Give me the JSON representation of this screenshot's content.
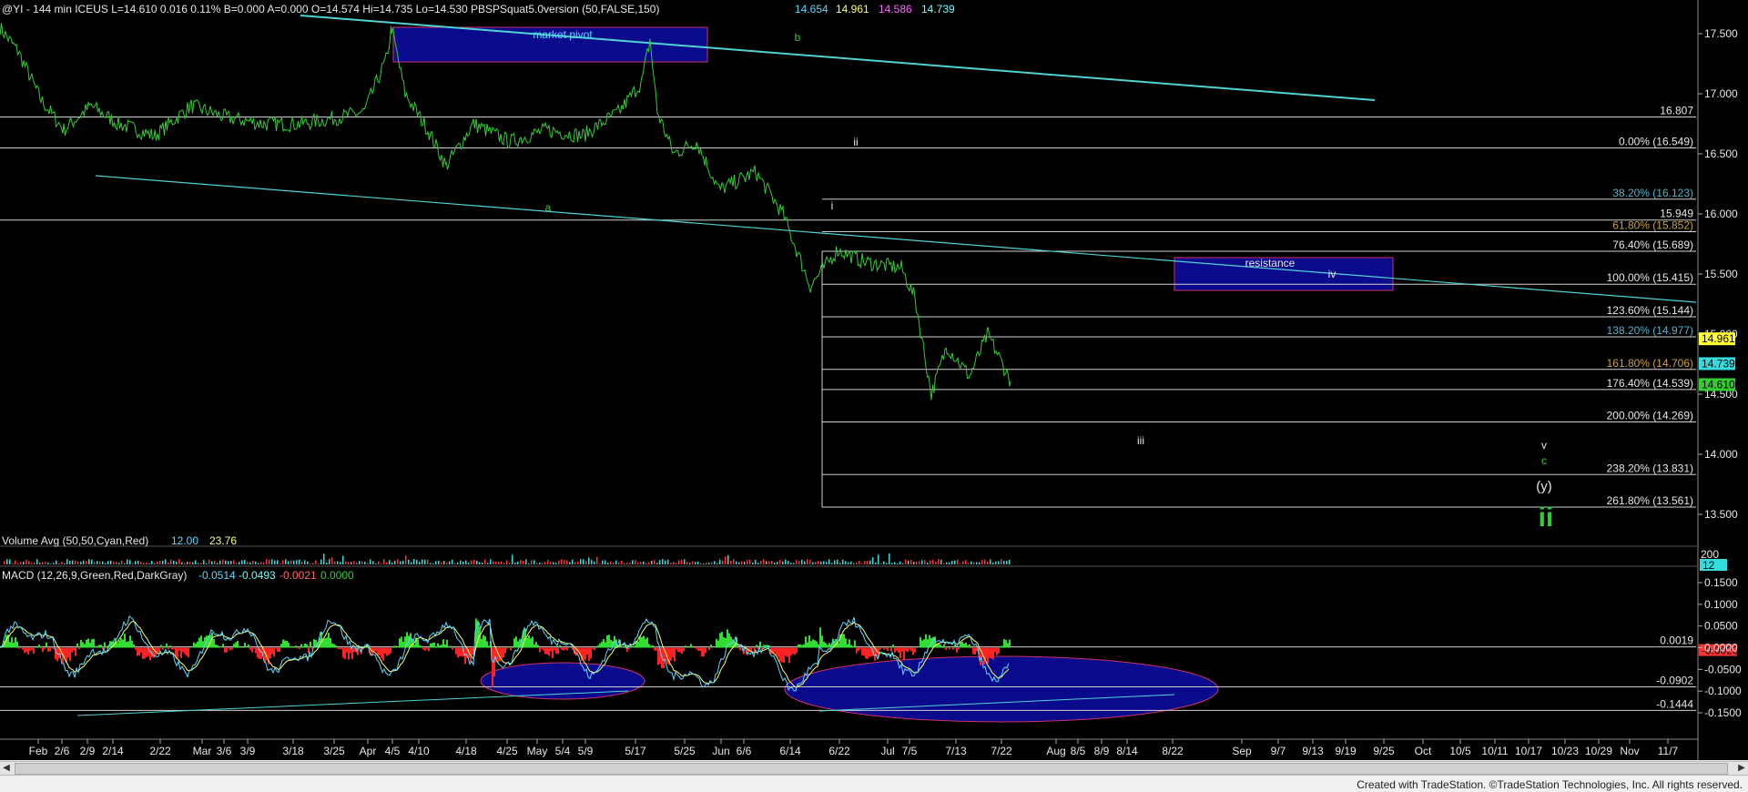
{
  "header": {
    "symbol_line": "@YI - 144 min  ICEUS  L=14.610  0.016  0.11%  B=0.000  A=0.000  O=14.574  Hi=14.735  Lo=14.530  PBSPSquat5.0version (50,FALSE,150)",
    "vals": [
      "14.654",
      "14.961",
      "14.586",
      "14.739"
    ],
    "val_colors": [
      "#5ad8ff",
      "#ffff66",
      "#ff66ff",
      "#66ffff"
    ]
  },
  "volume_header": {
    "text": "Volume Avg (50,50,Cyan,Red)",
    "v1": "12.00",
    "v2": "23.76"
  },
  "macd_header": {
    "text": "MACD (12,26,9,Green,Red,DarkGray)",
    "vals": [
      "-0.0514",
      "-0.0493",
      "-0.0021",
      "0.0000"
    ],
    "val_colors": [
      "#5ad8ff",
      "#66ffff",
      "#ff6666",
      "#33cc33"
    ]
  },
  "annotations": {
    "market_pivot": "market pivot",
    "resistance": "resistance",
    "waves": {
      "a": "a",
      "b": "b",
      "i": "i",
      "ii": "ii",
      "iii": "iii",
      "iv": "iv",
      "v": "v",
      "c": "c",
      "y": "(y)",
      "big_ii": "ii"
    }
  },
  "footer": "Created with TradeStation. ©TradeStation Technologies, Inc. All rights reserved.",
  "colors": {
    "price": "#33cc33",
    "trend": "#4fd2d2",
    "box": "#0a0a8c",
    "box_border": "#cc3366",
    "fib": "#e6e6e6"
  },
  "chart_data": [
    {
      "type": "line",
      "panel": "price",
      "ylim": [
        13.3,
        17.75
      ],
      "y_ticks": [
        "17.500",
        "17.000",
        "16.500",
        "16.000",
        "15.500",
        "15.000",
        "14.500",
        "14.000",
        "13.500"
      ],
      "x_ticks": [
        "Feb",
        "2/6",
        "2/9",
        "2/14",
        "2/22",
        "Mar",
        "3/6",
        "3/9",
        "3/18",
        "3/25",
        "Apr",
        "4/5",
        "4/10",
        "4/18",
        "4/25",
        "May",
        "5/4",
        "5/9",
        "5/17",
        "5/25",
        "Jun",
        "6/6",
        "6/14",
        "6/22",
        "Jul",
        "7/5",
        "7/13",
        "7/22",
        "Aug",
        "8/5",
        "8/9",
        "8/14",
        "8/22",
        "Sep",
        "9/7",
        "9/13",
        "9/19",
        "9/25",
        "Oct",
        "10/5",
        "10/11",
        "10/17",
        "10/23",
        "10/29",
        "Nov",
        "11/7"
      ],
      "price_key": [
        {
          "x": 0,
          "y": 17.55
        },
        {
          "x": 20,
          "y": 17.35
        },
        {
          "x": 45,
          "y": 16.95
        },
        {
          "x": 70,
          "y": 16.7
        },
        {
          "x": 100,
          "y": 16.9
        },
        {
          "x": 130,
          "y": 16.75
        },
        {
          "x": 170,
          "y": 16.65
        },
        {
          "x": 210,
          "y": 16.9
        },
        {
          "x": 250,
          "y": 16.8
        },
        {
          "x": 290,
          "y": 16.75
        },
        {
          "x": 330,
          "y": 16.75
        },
        {
          "x": 370,
          "y": 16.8
        },
        {
          "x": 400,
          "y": 16.85
        },
        {
          "x": 425,
          "y": 17.3
        },
        {
          "x": 430,
          "y": 17.55
        },
        {
          "x": 445,
          "y": 17.0
        },
        {
          "x": 470,
          "y": 16.7
        },
        {
          "x": 490,
          "y": 16.4
        },
        {
          "x": 520,
          "y": 16.75
        },
        {
          "x": 560,
          "y": 16.6
        },
        {
          "x": 600,
          "y": 16.7
        },
        {
          "x": 640,
          "y": 16.65
        },
        {
          "x": 680,
          "y": 16.85
        },
        {
          "x": 705,
          "y": 17.1
        },
        {
          "x": 714,
          "y": 17.45
        },
        {
          "x": 722,
          "y": 16.85
        },
        {
          "x": 740,
          "y": 16.5
        },
        {
          "x": 765,
          "y": 16.6
        },
        {
          "x": 790,
          "y": 16.2
        },
        {
          "x": 830,
          "y": 16.35
        },
        {
          "x": 860,
          "y": 16.0
        },
        {
          "x": 890,
          "y": 15.4
        },
        {
          "x": 920,
          "y": 15.7
        },
        {
          "x": 950,
          "y": 15.6
        },
        {
          "x": 990,
          "y": 15.55
        },
        {
          "x": 1005,
          "y": 15.3
        },
        {
          "x": 1023,
          "y": 14.5
        },
        {
          "x": 1040,
          "y": 14.9
        },
        {
          "x": 1065,
          "y": 14.65
        },
        {
          "x": 1085,
          "y": 15.0
        },
        {
          "x": 1110,
          "y": 14.61
        }
      ],
      "fib_levels": [
        {
          "label": "0.00% (16.549)",
          "value": 16.549
        },
        {
          "label": "38.20% (16.123)",
          "value": 16.123
        },
        {
          "label": "61.80% (15.852)",
          "value": 15.852
        },
        {
          "label": "76.40% (15.689)",
          "value": 15.689
        },
        {
          "label": "100.00% (15.415)",
          "value": 15.415
        },
        {
          "label": "123.60% (15.144)",
          "value": 15.144
        },
        {
          "label": "138.20% (14.977)",
          "value": 14.977
        },
        {
          "label": "161.80% (14.706)",
          "value": 14.706
        },
        {
          "label": "176.40% (14.539)",
          "value": 14.539
        },
        {
          "label": "200.00% (14.269)",
          "value": 14.269
        },
        {
          "label": "238.20% (13.831)",
          "value": 13.831
        },
        {
          "label": "261.80% (13.561)",
          "value": 13.561
        }
      ],
      "fib_colors": [
        "#e6e6e6",
        "#58b0c8",
        "#c8a23c",
        "#e6e6e6",
        "#e6e6e6",
        "#e6e6e6",
        "#58b0c8",
        "#c8a23c",
        "#e6e6e6",
        "#e6e6e6",
        "#e6e6e6",
        "#e6e6e6"
      ],
      "horizontal_levels": [
        {
          "label": "16.807",
          "value": 16.807
        },
        {
          "label": "15.949",
          "value": 15.949
        }
      ],
      "price_tags": [
        {
          "label": "14.961",
          "value": 14.961,
          "color": "#ffff33",
          "text_color": "#000"
        },
        {
          "label": "14.739",
          "value": 14.739,
          "color": "#33dddd",
          "text_color": "#000"
        },
        {
          "label": "14.610",
          "value": 14.61,
          "color": "#33cc33",
          "text_color": "#000"
        }
      ]
    },
    {
      "type": "bar",
      "panel": "volume",
      "y_ticks": [
        "200",
        "12"
      ]
    },
    {
      "type": "line",
      "panel": "macd",
      "ylim": [
        -0.175,
        0.16
      ],
      "y_ticks": [
        "0.1500",
        "0.1000",
        "0.0500",
        "0.0000",
        "-0.0500",
        "-0.1000",
        "-0.1500"
      ],
      "levels": [
        {
          "label": "0.0019",
          "value": 0.0019,
          "color": "#e6e6e6",
          "text_color": "#e6e6e6"
        },
        {
          "label": "-0.0023",
          "value": -0.0023,
          "color": "#ff3333",
          "text_color": "#000"
        },
        {
          "label": "-0.0902",
          "value": -0.0902,
          "color": "#e6e6e6",
          "text_color": "#e6e6e6"
        },
        {
          "label": "-0.1444",
          "value": -0.1444,
          "color": "#e6e6e6",
          "text_color": "#e6e6e6"
        }
      ]
    }
  ]
}
